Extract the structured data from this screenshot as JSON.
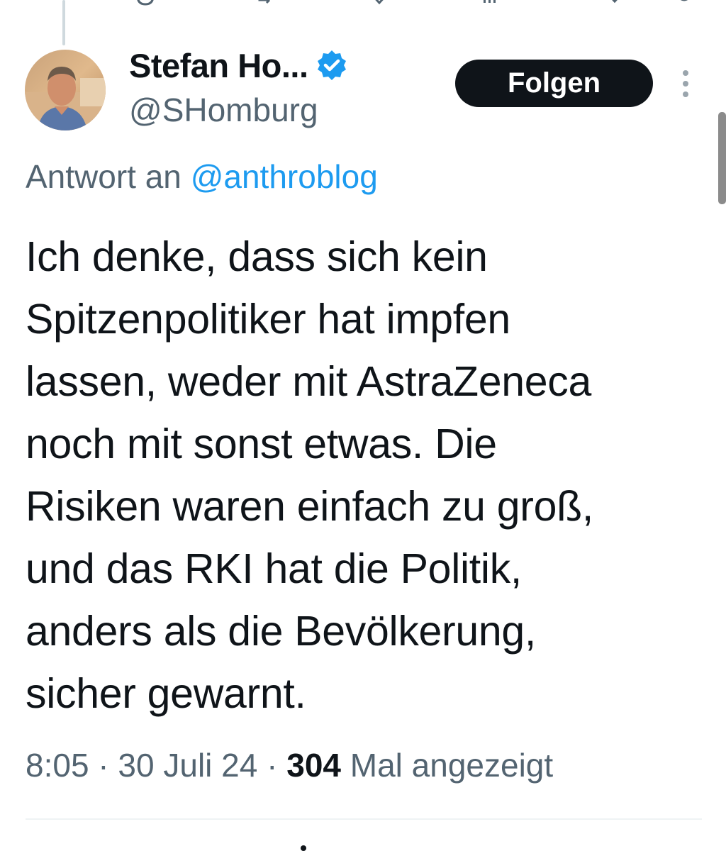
{
  "thread": {
    "display_name": "Stefan Ho...",
    "handle": "@SHomburg",
    "follow_label": "Folgen",
    "reply_prefix": "Antwort an ",
    "reply_mention": "@anthroblog",
    "text": "Ich denke, dass sich kein\nSpitzenpolitiker hat impfen\nlassen, weder mit AstraZeneca\nnoch mit sonst etwas. Die\nRisiken waren einfach zu groß,\nund das RKI hat die Politik,\nanders als die Bevölkerung,\nsicher gewarnt.",
    "time": "8:05",
    "separator": " · ",
    "date": "30 Juli 24",
    "views_count": "304",
    "views_suffix": " Mal angezeigt"
  },
  "icons": {
    "verified": "verified-badge-icon",
    "more": "more-vertical-icon",
    "previous_actions": [
      "reply-icon",
      "repost-icon",
      "like-icon",
      "views-icon",
      "bookmark-icon",
      "share-icon"
    ]
  },
  "colors": {
    "accent": "#1d9bf0",
    "text_primary": "#0f1419",
    "text_secondary": "#536471",
    "button_bg": "#0f1419",
    "divider": "#eff3f4"
  }
}
